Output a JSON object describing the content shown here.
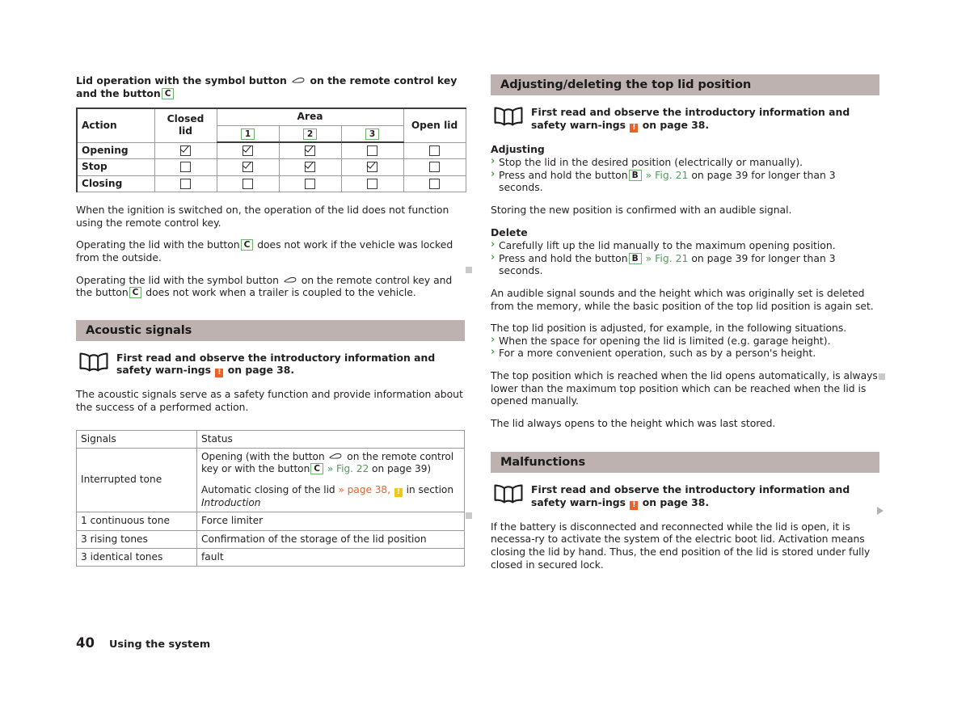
{
  "document": {
    "page_number": "40",
    "chapter": "Using the system"
  },
  "left_column": {
    "table_caption": {
      "part1": "Lid operation with the symbol button",
      "car_symbol": "car-boot-symbol",
      "part2": "on the remote control key and the button",
      "button_label": "C"
    },
    "action_table": {
      "headers": {
        "action": "Action",
        "closed_lid": "Closed lid",
        "area": "Area",
        "area_cols": [
          "1",
          "2",
          "3"
        ],
        "open_lid": "Open lid"
      },
      "rows": [
        {
          "label": "Opening",
          "closed": true,
          "area": [
            true,
            true,
            false
          ],
          "open": false
        },
        {
          "label": "Stop",
          "closed": false,
          "area": [
            true,
            true,
            true
          ],
          "open": false
        },
        {
          "label": "Closing",
          "closed": false,
          "area": [
            false,
            false,
            false
          ],
          "open": false
        }
      ]
    },
    "paragraphs": {
      "p1": "When the ignition is switched on, the operation of the lid does not function using the remote control key.",
      "p2_a": "Operating the lid with the button",
      "p2_btn": "C",
      "p2_b": "does not work if the vehicle was locked from the outside.",
      "p3_a": "Operating the lid with the symbol button",
      "p3_b": "on the remote control key and the button",
      "p3_btn": "C",
      "p3_c": "does not work when a trailer is coupled to the vehicle."
    },
    "acoustic_section": {
      "heading": "Acoustic signals",
      "note_a": "First read and observe the introductory information and safety warn-ings",
      "note_warn": "!",
      "note_b": "on page 38.",
      "intro": "The acoustic signals serve as a safety function and provide information about the success of a performed action."
    },
    "signals_table": {
      "headers": {
        "signals": "Signals",
        "status": "Status"
      },
      "rows": [
        {
          "signal": "Interrupted tone",
          "status_line1_a": "Opening (with the button",
          "status_line1_b": "on the remote control key or with the button",
          "status_line1_btn": "C",
          "status_line1_ref": "» Fig. 22",
          "status_line1_c": "on page 39)",
          "status_line2_a": "Automatic closing of the lid",
          "status_line2_ref": "» page 38,",
          "status_line2_warn": "!",
          "status_line2_b": "in section",
          "status_line2_ital": "Introduction"
        },
        {
          "signal": "1 continuous tone",
          "status": "Force limiter"
        },
        {
          "signal": "3 rising tones",
          "status": "Confirmation of the storage of the lid position"
        },
        {
          "signal": "3 identical tones",
          "status": "fault"
        }
      ]
    }
  },
  "right_column": {
    "adjust_section": {
      "heading": "Adjusting/deleting the top lid position",
      "note_a": "First read and observe the introductory information and safety warn-ings",
      "note_warn": "!",
      "note_b": "on page 38.",
      "adjusting_head": "Adjusting",
      "adjusting_items": [
        {
          "text_a": "Stop the lid in the desired position (electrically or manually)."
        },
        {
          "text_a": "Press and hold the button",
          "btn": "B",
          "ref": "» Fig. 21",
          "text_b": "on page 39 for longer than 3 seconds."
        }
      ],
      "storing": "Storing the new position is confirmed with an audible signal.",
      "delete_head": "Delete",
      "delete_items": [
        {
          "text_a": "Carefully lift up the lid manually to the maximum opening position."
        },
        {
          "text_a": "Press and hold the button",
          "btn": "B",
          "ref": "» Fig. 21",
          "text_b": "on page 39 for longer than 3 seconds."
        }
      ],
      "audible": "An audible signal sounds and the height which was originally set is deleted from the memory, while the basic position of the top lid position is again set.",
      "situations_lead": "The top lid position is adjusted, for example, in the following situations.",
      "situations": [
        "When the space for opening the lid is limited (e.g. garage height).",
        "For a more convenient operation, such as by a person's height."
      ],
      "top_position": "The top position which is reached when the lid opens automatically, is always lower than the maximum top position which can be reached when the lid is opened manually.",
      "last_stored": "The lid always opens to the height which was last stored."
    },
    "malfunctions_section": {
      "heading": "Malfunctions",
      "note_a": "First read and observe the introductory information and safety warn-ings",
      "note_warn": "!",
      "note_b": "on page 38.",
      "body": "If the battery is disconnected and reconnected while the lid is open, it is necessa-ry to activate the system of the electric boot lid. Activation means closing the lid by hand. Thus, the end position of the lid is stored under fully closed in secured lock."
    }
  },
  "markers": {
    "square": "end-of-section-marker",
    "triangle": "continued-marker"
  },
  "colors": {
    "section_bar": "#bdb2af",
    "ref_green": "#4d9e56",
    "ref_orange": "#e8622a",
    "warn_orange": "#e8622a",
    "warn_yellow": "#f5c518",
    "box_border_green": "#6cb26c",
    "text": "#231f20"
  }
}
